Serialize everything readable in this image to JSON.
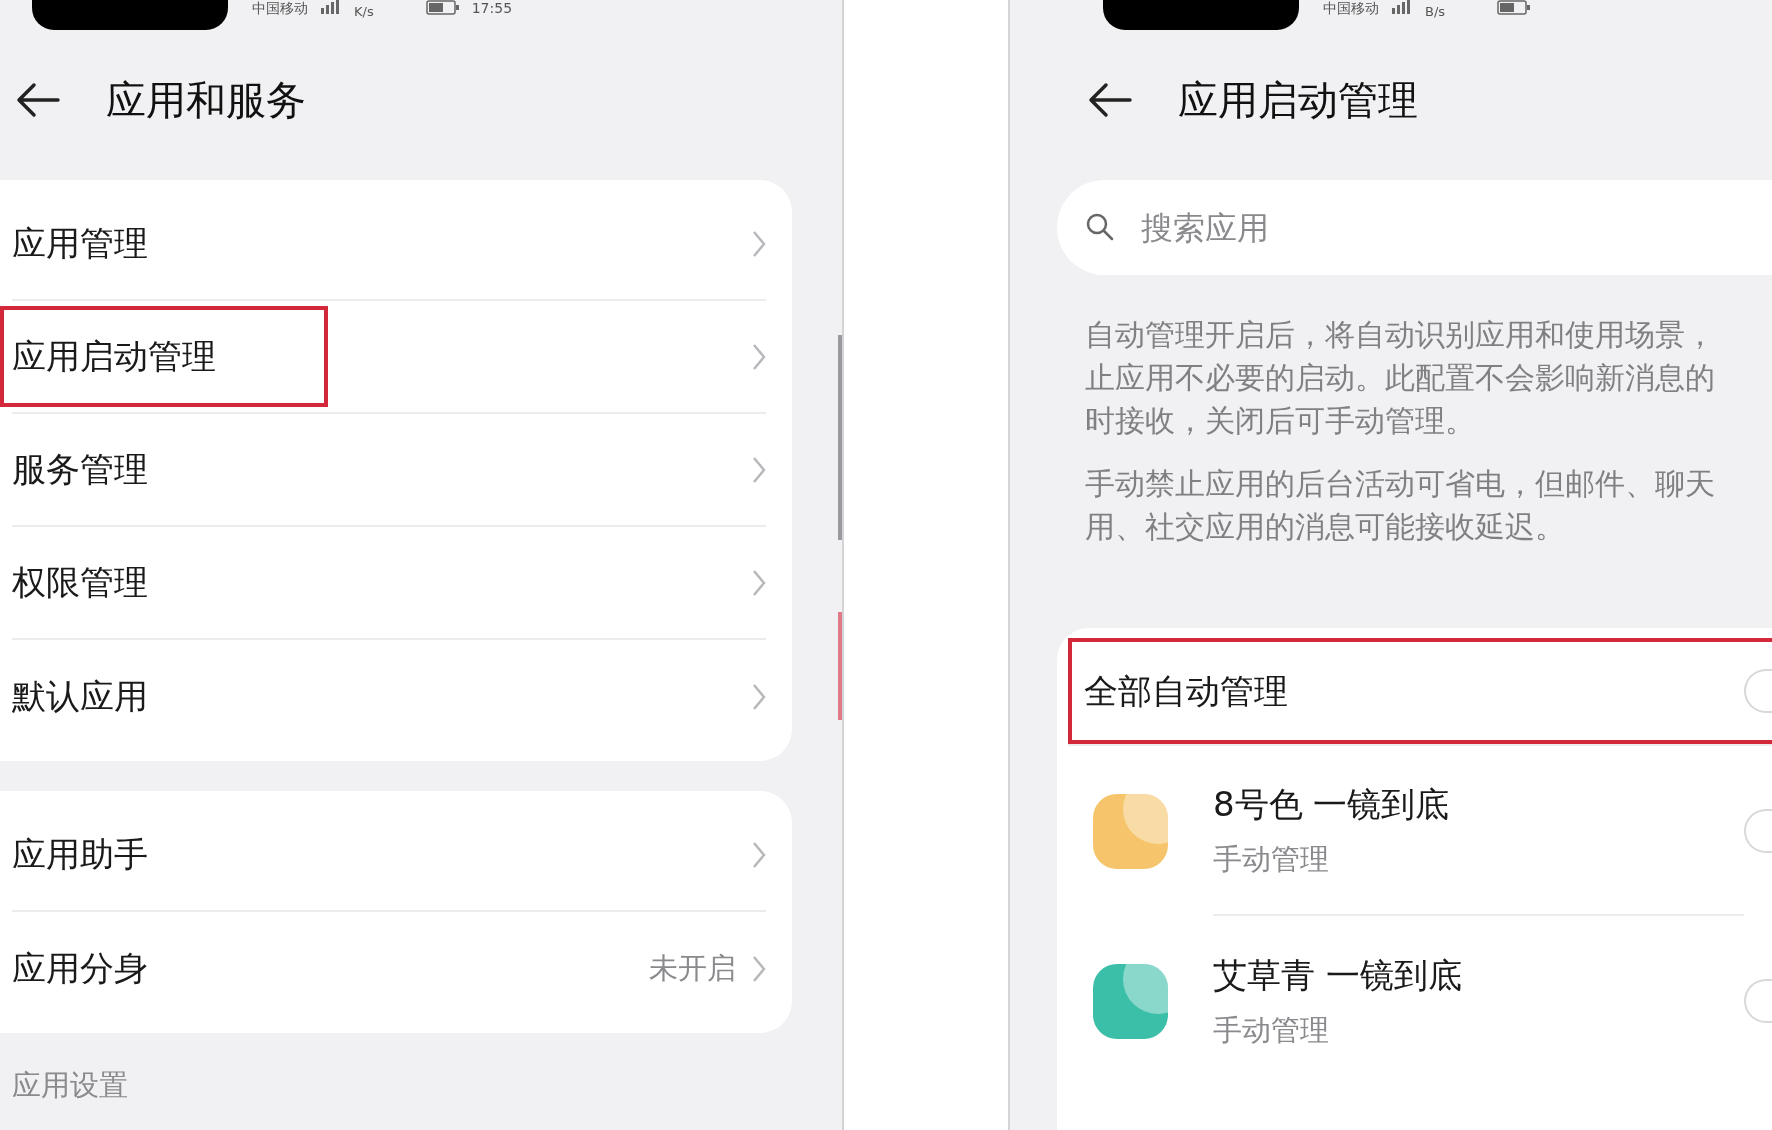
{
  "left_screen": {
    "status_bar": {
      "carrier": "中国移动",
      "speed": "K/s",
      "time": "17:55"
    },
    "title": "应用和服务",
    "groups": [
      [
        {
          "label": "应用管理",
          "highlighted": false
        },
        {
          "label": "应用启动管理",
          "highlighted": true
        },
        {
          "label": "服务管理",
          "highlighted": false
        },
        {
          "label": "权限管理",
          "highlighted": false
        },
        {
          "label": "默认应用",
          "highlighted": false
        }
      ],
      [
        {
          "label": "应用助手",
          "highlighted": false
        },
        {
          "label": "应用分身",
          "value": "未开启",
          "highlighted": false
        }
      ]
    ],
    "section_heading": "应用设置"
  },
  "right_screen": {
    "status_bar": {
      "carrier": "中国移动",
      "speed": "B/s"
    },
    "title": "应用启动管理",
    "search": {
      "placeholder": "搜索应用"
    },
    "notes": [
      {
        "lines": [
          "自动管理开启后，将自动识别应用和使用场景，",
          "止应用不必要的启动。此配置不会影响新消息的",
          "时接收，关闭后可手动管理。"
        ]
      },
      {
        "lines": [
          "手动禁止应用的后台活动可省电，但邮件、聊天",
          "用、社交应用的消息可能接收延迟。"
        ]
      }
    ],
    "master": {
      "label": "全部自动管理",
      "on": false,
      "highlighted": true
    },
    "apps": [
      {
        "name": "8号色 一镜到底",
        "status": "手动管理",
        "on": false,
        "color": "#f6c46a"
      },
      {
        "name": "艾草青 一镜到底",
        "status": "手动管理",
        "on": false,
        "color": "#3cbfa8"
      }
    ]
  }
}
